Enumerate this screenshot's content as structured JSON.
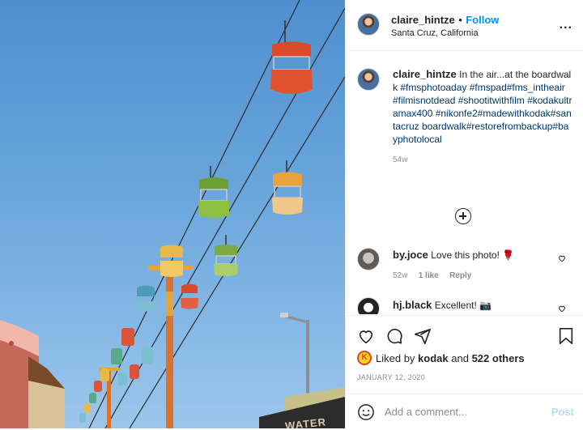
{
  "post": {
    "username": "claire_hintze",
    "follow_label": "Follow",
    "follow_separator": "•",
    "location": "Santa Cruz, California",
    "options_label": "..."
  },
  "caption": {
    "username": "claire_hintze",
    "text": "In the air...at the boardwalk",
    "hashtags": "#fmsphotoaday #fmspad#fms_intheair #filmisnotdead #shootitwithfilm #kodakultramax400 #nikonfe2#madewithkodak#santacruz boardwalk#restorefrombackup#bayphotolocal",
    "time": "54w"
  },
  "comments": [
    {
      "username": "by.joce",
      "text": "Love this photo! 🌹",
      "time": "52w",
      "likes": "1 like",
      "reply": "Reply"
    },
    {
      "username": "hj.black",
      "text": "Excellent! 📷"
    }
  ],
  "likes": {
    "prefix": "Liked by",
    "user": "kodak",
    "middle": "and",
    "others": "522 others"
  },
  "date": "JANUARY 12, 2020",
  "add_comment": {
    "placeholder": "Add a comment...",
    "post_label": "Post"
  },
  "photo": {
    "sign_text": "WATER"
  },
  "colors": {
    "link": "#0095f6",
    "hashtag": "#00376b",
    "muted": "#8e8e8e",
    "post_disabled": "#b2dffc"
  }
}
